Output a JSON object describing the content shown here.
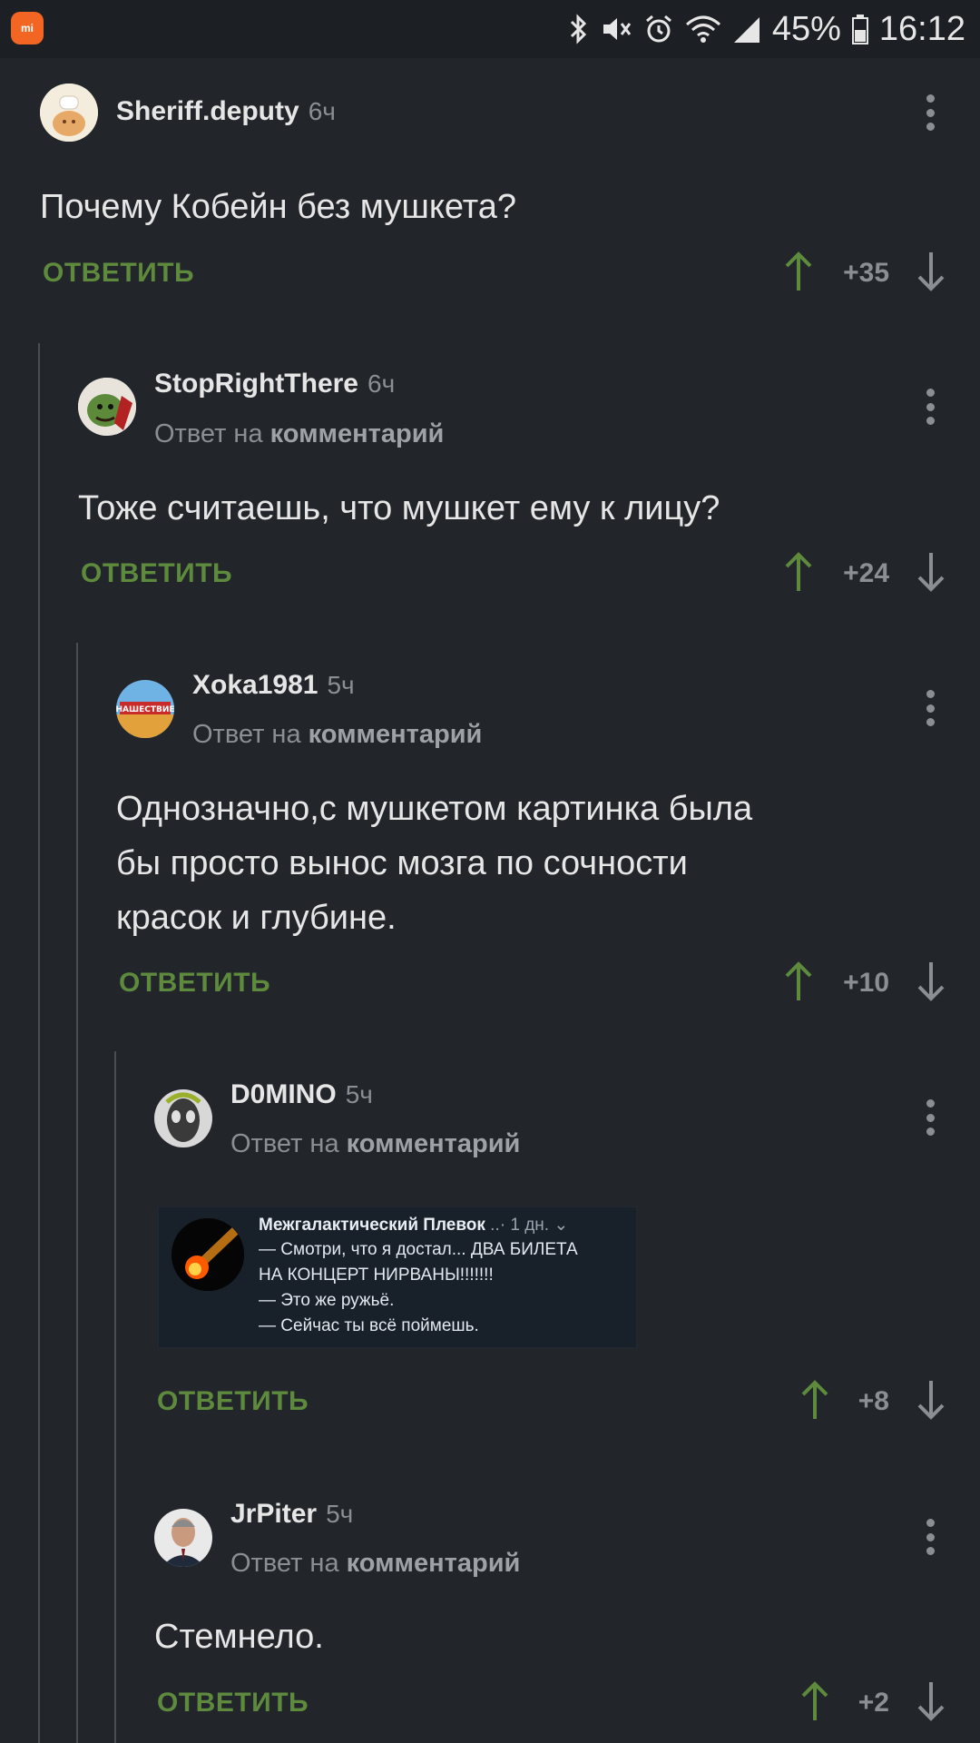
{
  "status_bar": {
    "battery": "45%",
    "time": "16:12",
    "icons": [
      "bluetooth-icon",
      "mute-icon",
      "alarm-icon",
      "wifi-icon",
      "signal-icon",
      "battery-icon"
    ]
  },
  "reply_label": "ОТВЕТИТЬ",
  "reply_to_prefix": "Ответ на",
  "reply_to_link": "комментарий",
  "comments": [
    {
      "author": "Sheriff.deputy",
      "time": "6ч",
      "text": "Почему Кобейн без мушкета?",
      "score": "+35"
    },
    {
      "author": "StopRightThere",
      "time": "6ч",
      "text": "Тоже считаешь, что мушкет ему к лицу?",
      "score": "+24"
    },
    {
      "author": "Xoka1981",
      "time": "5ч",
      "text_lines": [
        "Однозначно,с мушкетом картинка была",
        "бы просто вынос мозга по сочности",
        "красок и глубине."
      ],
      "score": "+10"
    },
    {
      "author": "D0MINO",
      "time": "5ч",
      "embed": {
        "title": "Межгалактический Плевок",
        "time": "1 дн.",
        "lines": [
          "— Смотри, что я достал... ДВА БИЛЕТА",
          "НА КОНЦЕРТ НИРВАНЫ!!!!!!!",
          "— Это же ружьё.",
          "— Сейчас ты всё поймешь."
        ]
      },
      "score": "+8"
    },
    {
      "author": "JrPiter",
      "time": "5ч",
      "text": "Стемнело.",
      "score": "+2"
    }
  ],
  "colors": {
    "background": "#22262b",
    "accent_green": "#5d8a3c",
    "muted": "#8b8f94",
    "thread_line": "#4a4e54"
  }
}
